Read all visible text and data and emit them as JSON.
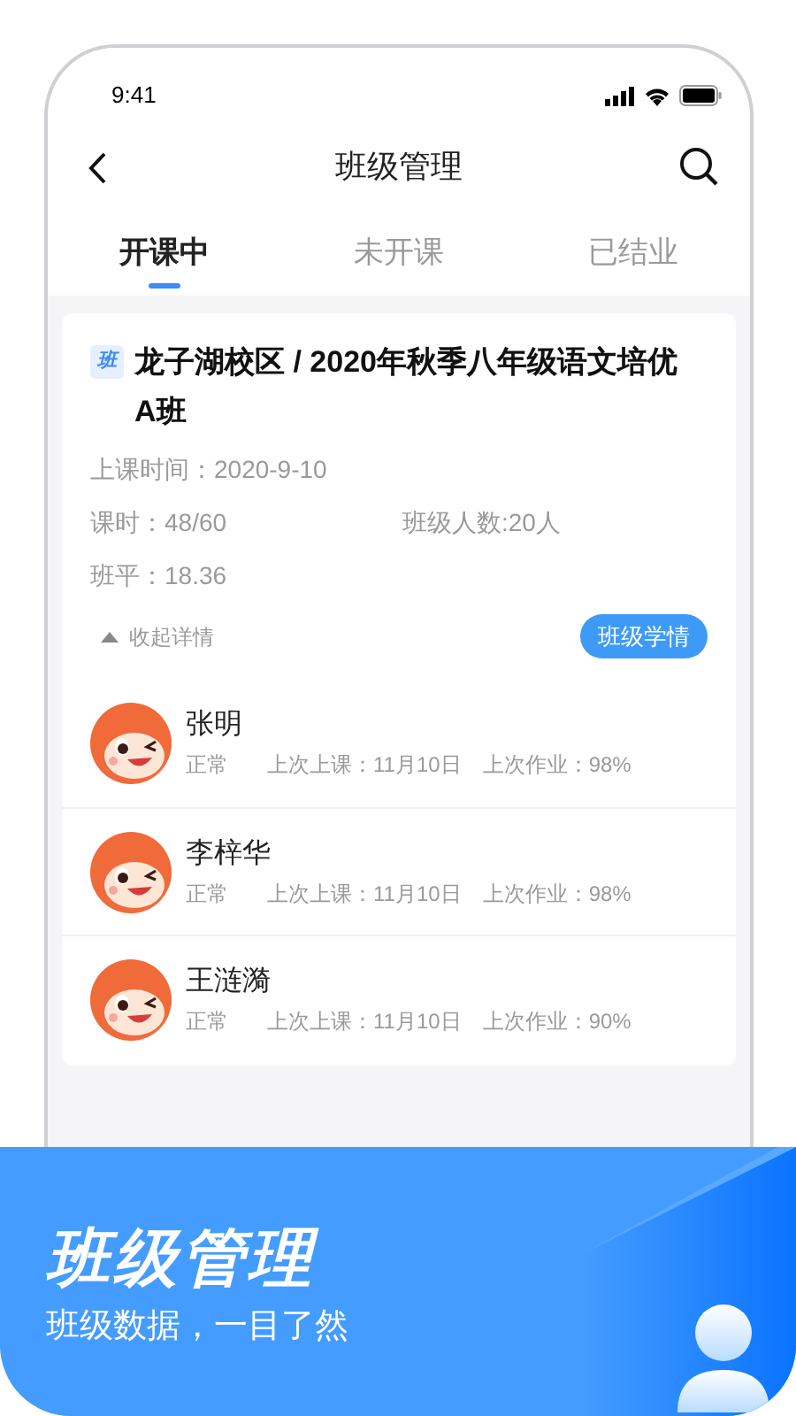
{
  "status_bar": {
    "time": "9:41"
  },
  "header": {
    "title": "班级管理"
  },
  "tabs": [
    {
      "label": "开课中",
      "selected": true
    },
    {
      "label": "未开课",
      "selected": false
    },
    {
      "label": "已结业",
      "selected": false
    }
  ],
  "class_card": {
    "badge": "班",
    "title": "龙子湖校区 / 2020年秋季八年级语文培优A班",
    "start_time": "上课时间：2020-9-10",
    "lessons": "课时：48/60",
    "headcount": "班级人数:20人",
    "average": "班平：18.36",
    "collapse": "收起详情",
    "stats_button": "班级学情",
    "students": [
      {
        "name": "张明",
        "status": "正常",
        "last_class": "上次上课：11月10日",
        "last_homework": "上次作业：98%"
      },
      {
        "name": "李梓华",
        "status": "正常",
        "last_class": "上次上课：11月10日",
        "last_homework": "上次作业：98%"
      },
      {
        "name": "王涟漪",
        "status": "正常",
        "last_class": "上次上课：11月10日",
        "last_homework": "上次作业：90%"
      }
    ]
  },
  "banner": {
    "title": "班级管理",
    "subtitle": "班级数据，一目了然"
  }
}
